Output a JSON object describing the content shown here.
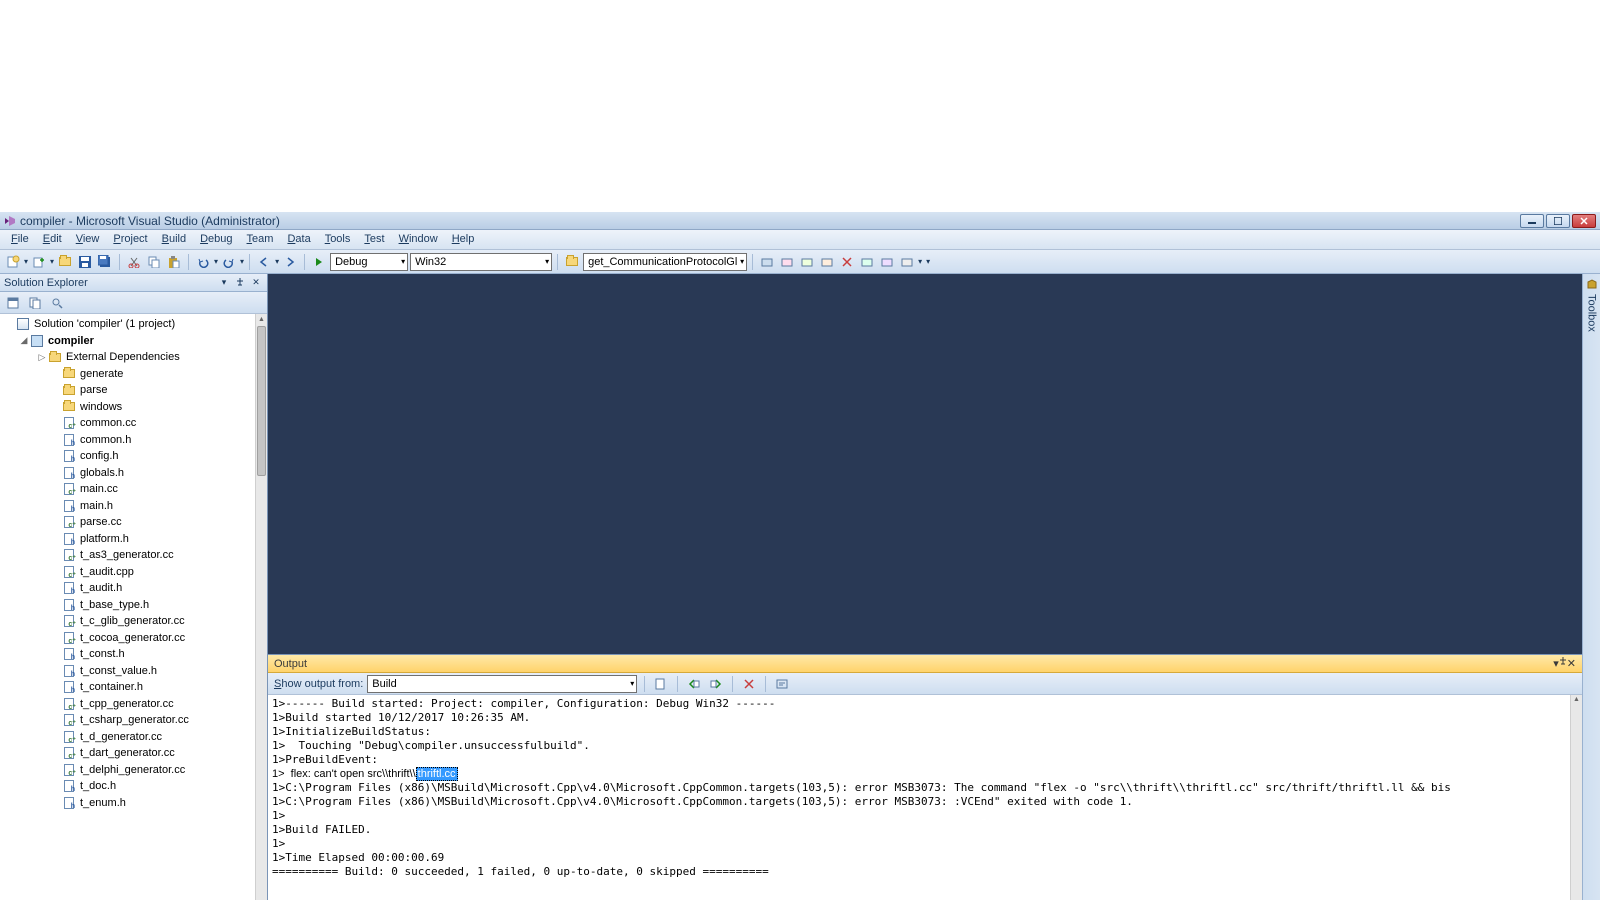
{
  "titlebar": {
    "title": "compiler - Microsoft Visual Studio (Administrator)"
  },
  "menus": [
    "File",
    "Edit",
    "View",
    "Project",
    "Build",
    "Debug",
    "Team",
    "Data",
    "Tools",
    "Test",
    "Window",
    "Help"
  ],
  "toolbar": {
    "config": "Debug",
    "platform": "Win32",
    "find": "get_CommunicationProtocolGl"
  },
  "solution_explorer": {
    "title": "Solution Explorer",
    "root": "Solution 'compiler' (1 project)",
    "project": "compiler",
    "ext_deps": "External Dependencies",
    "folders": [
      "generate",
      "parse",
      "windows"
    ],
    "files": [
      {
        "n": "common.cc",
        "t": "cc"
      },
      {
        "n": "common.h",
        "t": "h"
      },
      {
        "n": "config.h",
        "t": "h"
      },
      {
        "n": "globals.h",
        "t": "h"
      },
      {
        "n": "main.cc",
        "t": "cc"
      },
      {
        "n": "main.h",
        "t": "h"
      },
      {
        "n": "parse.cc",
        "t": "cc"
      },
      {
        "n": "platform.h",
        "t": "h"
      },
      {
        "n": "t_as3_generator.cc",
        "t": "cc"
      },
      {
        "n": "t_audit.cpp",
        "t": "cc"
      },
      {
        "n": "t_audit.h",
        "t": "h"
      },
      {
        "n": "t_base_type.h",
        "t": "h"
      },
      {
        "n": "t_c_glib_generator.cc",
        "t": "cc"
      },
      {
        "n": "t_cocoa_generator.cc",
        "t": "cc"
      },
      {
        "n": "t_const.h",
        "t": "h"
      },
      {
        "n": "t_const_value.h",
        "t": "h"
      },
      {
        "n": "t_container.h",
        "t": "h"
      },
      {
        "n": "t_cpp_generator.cc",
        "t": "cc"
      },
      {
        "n": "t_csharp_generator.cc",
        "t": "cc"
      },
      {
        "n": "t_d_generator.cc",
        "t": "cc"
      },
      {
        "n": "t_dart_generator.cc",
        "t": "cc"
      },
      {
        "n": "t_delphi_generator.cc",
        "t": "cc"
      },
      {
        "n": "t_doc.h",
        "t": "h"
      },
      {
        "n": "t_enum.h",
        "t": "h"
      }
    ]
  },
  "output": {
    "title": "Output",
    "show_from_label": "Show output from:",
    "show_from_value": "Build",
    "lines_pre": "1>------ Build started: Project: compiler, Configuration: Debug Win32 ------\n1>Build started 10/12/2017 10:26:35 AM.\n1>InitializeBuildStatus:\n1>  Touching \"Debug\\compiler.unsuccessfulbuild\".\n1>PreBuildEvent:",
    "flex_prefix": "1>  flex: can't open src\\\\thrift\\\\",
    "flex_highlight": "thriftl.cc",
    "lines_post": "1>C:\\Program Files (x86)\\MSBuild\\Microsoft.Cpp\\v4.0\\Microsoft.CppCommon.targets(103,5): error MSB3073: The command \"flex -o \"src\\\\thrift\\\\thriftl.cc\" src/thrift/thriftl.ll && bis\n1>C:\\Program Files (x86)\\MSBuild\\Microsoft.Cpp\\v4.0\\Microsoft.CppCommon.targets(103,5): error MSB3073: :VCEnd\" exited with code 1.\n1>\n1>Build FAILED.\n1>\n1>Time Elapsed 00:00:00.69\n========== Build: 0 succeeded, 1 failed, 0 up-to-date, 0 skipped =========="
  },
  "toolbox": {
    "label": "Toolbox"
  }
}
